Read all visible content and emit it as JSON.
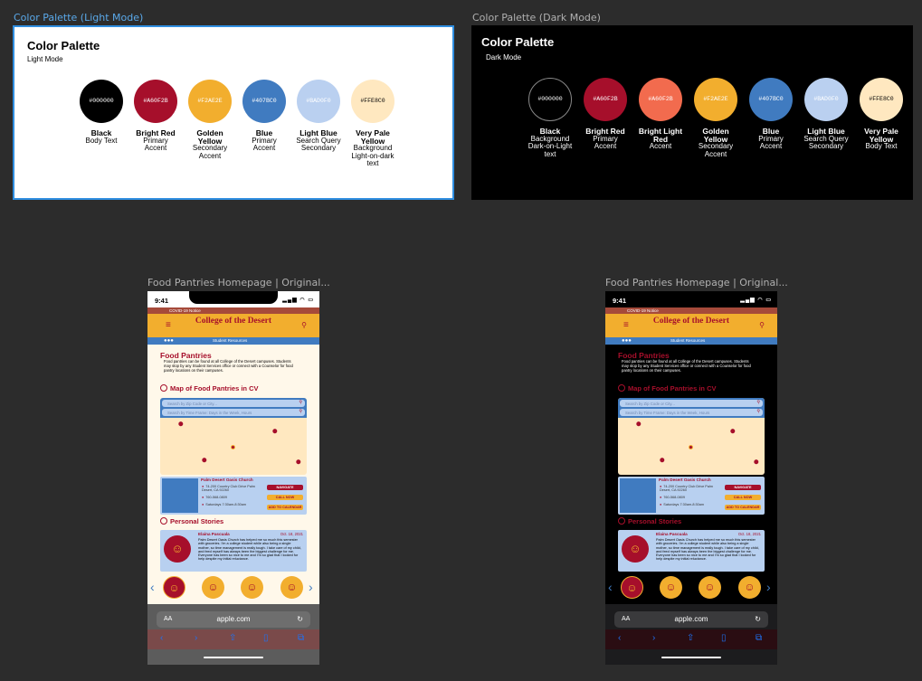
{
  "frames": {
    "light_palette_label": "Color Palette (Light Mode)",
    "dark_palette_label": "Color Palette (Dark Mode)",
    "phone_light_label": "Food Pantries Homepage | Original...",
    "phone_dark_label": "Food Pantries Homepage | Original..."
  },
  "light": {
    "title": "Color Palette",
    "subtitle": "Light Mode",
    "swatches": [
      {
        "hex": "#000000",
        "name": "Black",
        "role": "Body Text",
        "color": "#000000",
        "text": "#ffffff"
      },
      {
        "hex": "#A60F2B",
        "name": "Bright Red",
        "role": "Primary Accent",
        "color": "#a60f2b",
        "text": "#ffffff"
      },
      {
        "hex": "#F2AE2E",
        "name": "Golden Yellow",
        "role": "Secondary Accent",
        "color": "#f2ae2e",
        "text": "#ffffff"
      },
      {
        "hex": "#407BC0",
        "name": "Blue",
        "role": "Primary Accent",
        "color": "#407bc0",
        "text": "#ffffff"
      },
      {
        "hex": "#BAD0F0",
        "name": "Light Blue",
        "role": "Search Query Secondary",
        "color": "#bad0f0",
        "text": "#ffffff"
      },
      {
        "hex": "#FFE8C0",
        "name": "Very Pale Yellow",
        "role": "Background Light-on-dark text",
        "color": "#ffe8c0",
        "text": "#000000"
      }
    ]
  },
  "dark": {
    "title": "Color Palette",
    "subtitle": "Dark Mode",
    "swatches": [
      {
        "hex": "#000000",
        "name": "Black",
        "role": "Background Dark-on-Light text",
        "color": "#000000",
        "text": "#ffffff"
      },
      {
        "hex": "#A60F2B",
        "name": "Bright Red",
        "role": "Primary Accent",
        "color": "#a60f2b",
        "text": "#ffffff"
      },
      {
        "hex": "#A60F2B",
        "name": "Bright Light Red",
        "role": "Accent",
        "color": "#f26b4e",
        "text": "#ffffff"
      },
      {
        "hex": "#F2AE2E",
        "name": "Golden Yellow",
        "role": "Secondary Accent",
        "color": "#f2ae2e",
        "text": "#ffffff"
      },
      {
        "hex": "#407BC0",
        "name": "Blue",
        "role": "Primary Accent",
        "color": "#407bc0",
        "text": "#ffffff"
      },
      {
        "hex": "#BAD0F0",
        "name": "Light Blue",
        "role": "Search Query Secondary",
        "color": "#bad0f0",
        "text": "#ffffff"
      },
      {
        "hex": "#FFE8C0",
        "name": "Very Pale Yellow",
        "role": "Body Text",
        "color": "#ffe8c0",
        "text": "#000000"
      }
    ]
  },
  "phone": {
    "time": "9:41",
    "signal": "▂▄▆ ◠ ▭",
    "covid": "COVID-19 Notice",
    "logo": "College of the Desert",
    "nav_dots": "●●●",
    "nav_label": "Student Resources",
    "page_title": "Food Pantries",
    "intro": "Food pantries can be found at all College of the Desert campuses. Students may stop by any Student Services office or connect with a Counselor for food pantry locations on their campuses.",
    "map_title": "Map of Food Pantries in CV",
    "search_zip": "Search by Zip Code or City...",
    "search_time": "Search by Time Frame: Days in the Week, Hours",
    "card": {
      "title": "Palm Desert Oasis Church",
      "address": "74-200 Country Club Drive Palm Desert, CA 92260",
      "phone": "760-568-0809",
      "hours": "Saturdays 7:30am-8:30am",
      "navigate": "NAVIGATE",
      "call": "CALL NOW",
      "calendar": "ADD TO CALENDAR"
    },
    "stories_title": "Personal Stories",
    "story": {
      "name": "Elaina Pascuala",
      "date": "Oct. 18, 2021",
      "text": "Palm Desert Oasis Church has helped me so much this semester with groceries. I'm a college student while also being a single mother, so time management is really tough. I take care of my child, and feed myself has always been the biggest challenge for me. Everyone has been so nice to me and I'm so glad that I looked for help despite my initial reluctance."
    },
    "url": "apple.com",
    "aa": "AA"
  }
}
